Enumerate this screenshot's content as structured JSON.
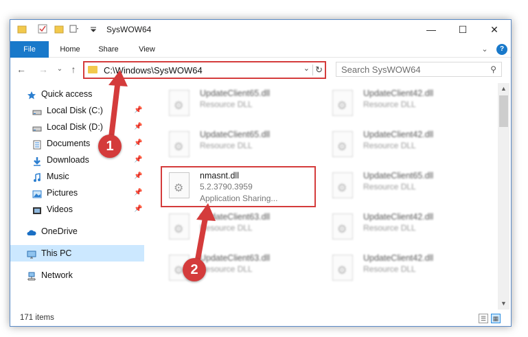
{
  "window": {
    "title": "SysWOW64",
    "minimize_glyph": "—",
    "maximize_glyph": "☐",
    "close_glyph": "✕"
  },
  "ribbon": {
    "tabs": [
      "File",
      "Home",
      "Share",
      "View"
    ],
    "expand_glyph": "⌄",
    "help_glyph": "?"
  },
  "nav": {
    "back_glyph": "←",
    "forward_glyph": "→",
    "recent_glyph": "⌄",
    "up_glyph": "↑"
  },
  "address": {
    "path": "C:\\Windows\\SysWOW64",
    "dropdown_glyph": "⌄",
    "refresh_glyph": "↻"
  },
  "search": {
    "placeholder": "Search SysWOW64",
    "icon_glyph": "⚲"
  },
  "sidebar": {
    "items": [
      {
        "label": "Quick access",
        "icon": "star-icon",
        "pinned": false
      },
      {
        "label": "Local Disk (C:)",
        "icon": "drive-icon",
        "pinned": true
      },
      {
        "label": "Local Disk (D:)",
        "icon": "drive-icon",
        "pinned": true
      },
      {
        "label": "Documents",
        "icon": "documents-icon",
        "pinned": true
      },
      {
        "label": "Downloads",
        "icon": "downloads-icon",
        "pinned": true
      },
      {
        "label": "Music",
        "icon": "music-icon",
        "pinned": true
      },
      {
        "label": "Pictures",
        "icon": "pictures-icon",
        "pinned": true
      },
      {
        "label": "Videos",
        "icon": "videos-icon",
        "pinned": true
      },
      {
        "label": "OneDrive",
        "icon": "cloud-icon",
        "pinned": false
      },
      {
        "label": "This PC",
        "icon": "computer-icon",
        "pinned": false
      },
      {
        "label": "Network",
        "icon": "network-icon",
        "pinned": false
      }
    ],
    "pin_glyph": "📌"
  },
  "files": [
    {
      "name": "UpdateClient65.dll",
      "desc": "Resource DLL",
      "version": "",
      "blurred": true
    },
    {
      "name": "UpdateClient42.dll",
      "desc": "Resource DLL",
      "version": "",
      "blurred": true
    },
    {
      "name": "UpdateClient65.dll",
      "desc": "Resource DLL",
      "version": "",
      "blurred": true
    },
    {
      "name": "UpdateClient42.dll",
      "desc": "Resource DLL",
      "version": "",
      "blurred": true
    },
    {
      "name": "nmasnt.dll",
      "version": "5.2.3790.3959",
      "desc": "Application Sharing...",
      "blurred": false
    },
    {
      "name": "UpdateClient65.dll",
      "desc": "Resource DLL",
      "version": "",
      "blurred": true
    },
    {
      "name": "UpdateClient63.dll",
      "desc": "Resource DLL",
      "version": "",
      "blurred": true
    },
    {
      "name": "UpdateClient42.dll",
      "desc": "Resource DLL",
      "version": "",
      "blurred": true
    },
    {
      "name": "UpdateClient63.dll",
      "desc": "Resource DLL",
      "version": "",
      "blurred": true
    },
    {
      "name": "UpdateClient42.dll",
      "desc": "Resource DLL",
      "version": "",
      "blurred": true
    }
  ],
  "statusbar": {
    "item_count": "171 items",
    "details_view_glyph": "☰",
    "tiles_view_glyph": "▦"
  },
  "annotations": {
    "callout_1": "1",
    "callout_2": "2",
    "color": "#d43b3b"
  },
  "colors": {
    "accent": "#1979ca",
    "selection": "#cce8ff",
    "folder": "#f2c94c",
    "highlight": "#d43b3b"
  }
}
